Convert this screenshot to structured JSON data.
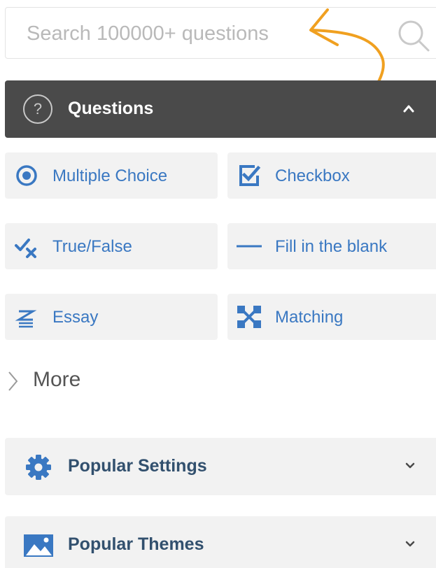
{
  "search": {
    "placeholder": "Search 100000+ questions",
    "icon": "search-icon"
  },
  "questions_panel": {
    "title": "Questions",
    "help_icon_label": "?",
    "expanded": true,
    "header_color": "#4a4a4a"
  },
  "question_types": [
    {
      "label": "Multiple Choice",
      "icon": "radio-button-icon"
    },
    {
      "label": "Checkbox",
      "icon": "checkbox-icon"
    },
    {
      "label": "True/False",
      "icon": "check-cross-icon"
    },
    {
      "label": "Fill in the blank",
      "icon": "dash-icon"
    },
    {
      "label": "Essay",
      "icon": "essay-lines-icon"
    },
    {
      "label": "Matching",
      "icon": "matching-icon"
    }
  ],
  "more": {
    "label": "More"
  },
  "sections": [
    {
      "label": "Popular Settings",
      "icon": "gear-icon",
      "expanded": false
    },
    {
      "label": "Popular Themes",
      "icon": "image-icon",
      "expanded": false
    }
  ],
  "colors": {
    "accent": "#3a78c2",
    "tile_bg": "#f2f2f2",
    "section_text": "#32506e",
    "annotation_arrow": "#f0a020"
  }
}
